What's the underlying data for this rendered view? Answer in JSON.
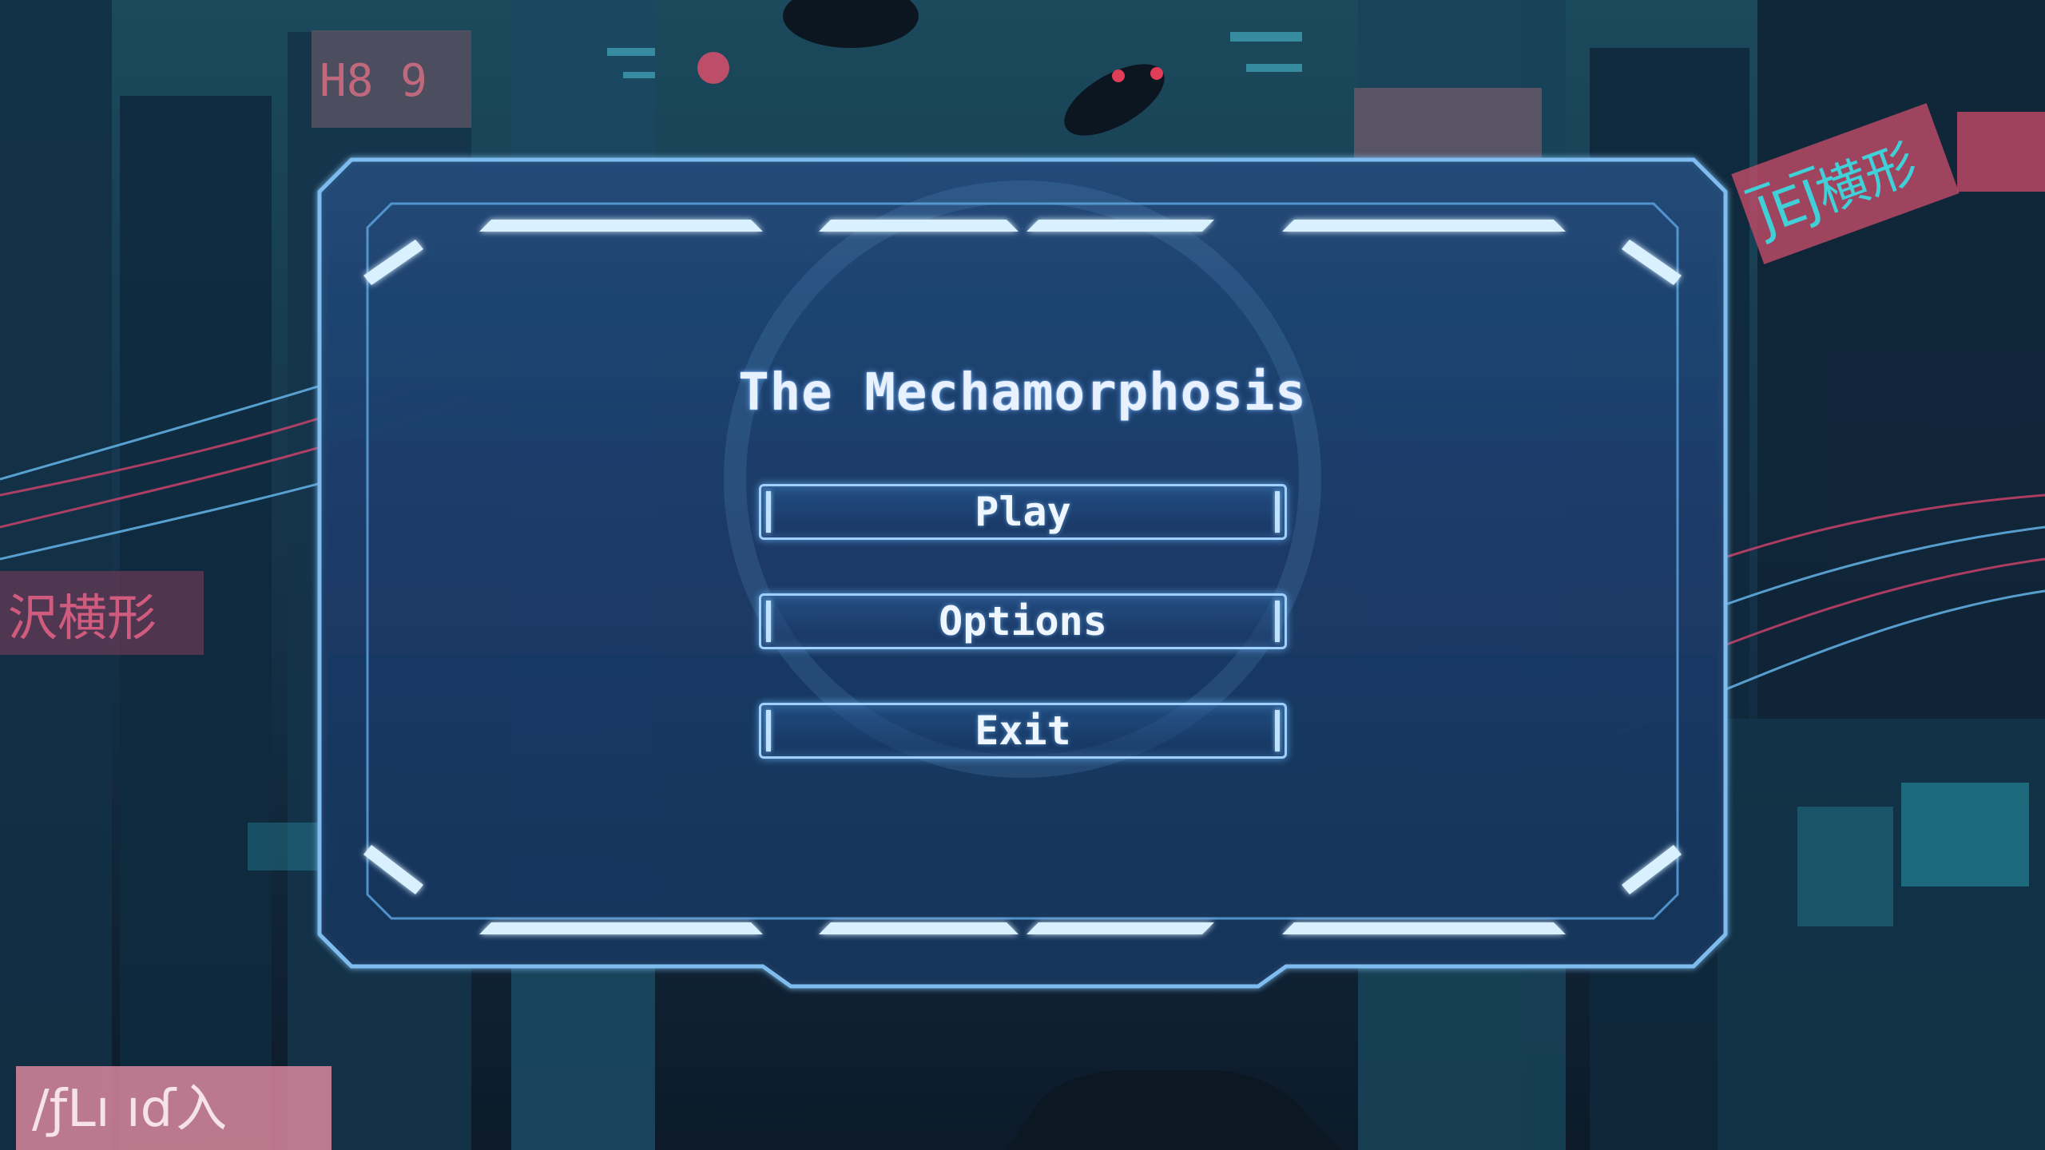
{
  "game": {
    "title": "The Mechamorphosis"
  },
  "menu": {
    "play_label": "Play",
    "options_label": "Options",
    "exit_label": "Exit"
  },
  "signs": {
    "top_left": "H8 9",
    "right_upper": "J̅EJ̅横形",
    "left_middle": "沢横形",
    "bottom_left": "/ƒLı ıɗ入"
  },
  "colors": {
    "accent_cyan": "#6fc6ff",
    "panel_glow": "#9fd0ff",
    "neon_pink": "#e0456e",
    "background": "#0b1c2a"
  }
}
